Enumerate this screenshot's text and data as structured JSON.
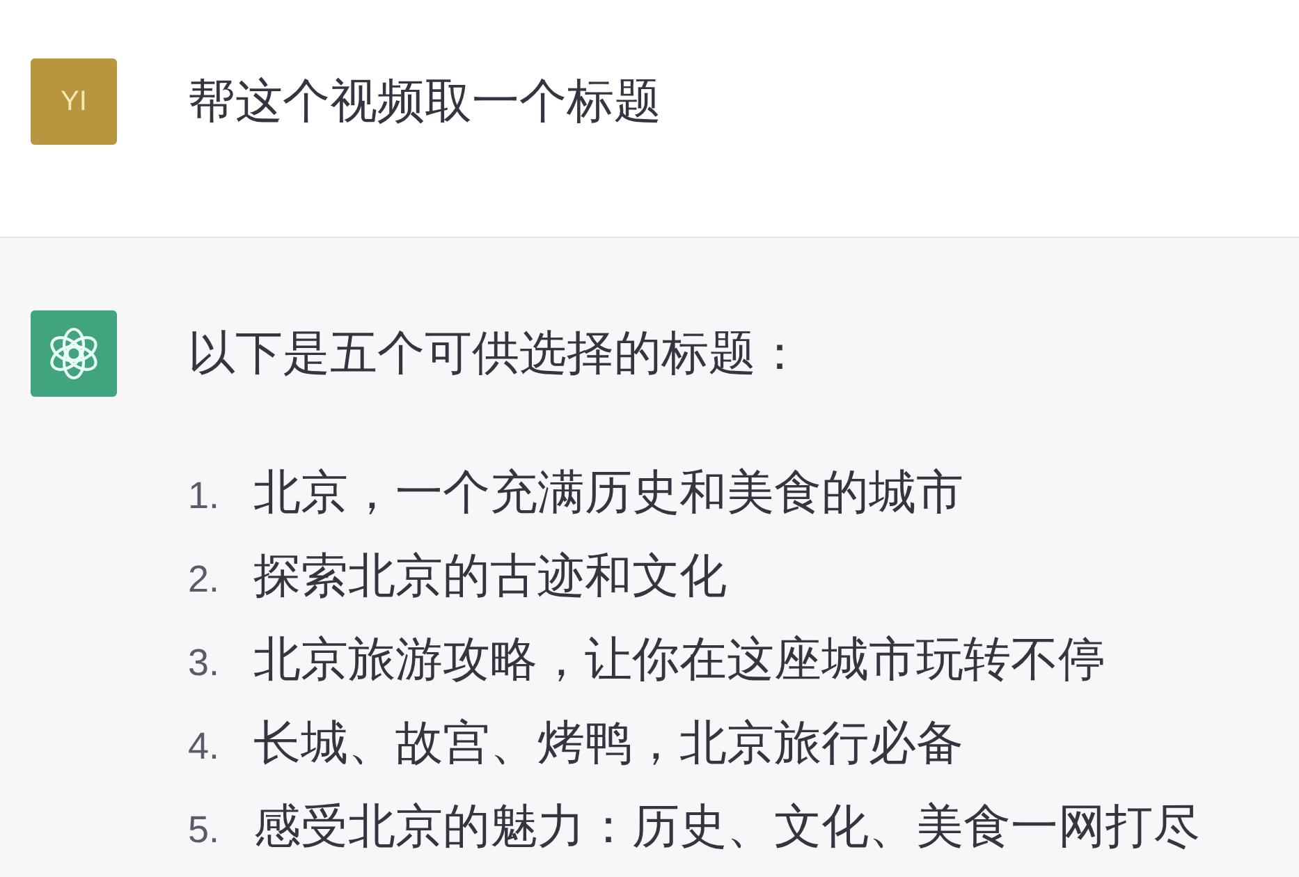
{
  "messages": [
    {
      "kind": "user",
      "avatar": {
        "kind": "initials",
        "text": "YI"
      },
      "text": "帮这个视频取一个标题"
    },
    {
      "kind": "assistant",
      "avatar": {
        "kind": "logo"
      },
      "text": "以下是五个可供选择的标题：",
      "list": [
        {
          "number": "1.",
          "text": "北京，一个充满历史和美食的城市"
        },
        {
          "number": "2.",
          "text": "探索北京的古迹和文化"
        },
        {
          "number": "3.",
          "text": "北京旅游攻略，让你在这座城市玩转不停"
        },
        {
          "number": "4.",
          "text": "长城、故宫、烤鸭，北京旅行必备"
        },
        {
          "number": "5.",
          "text": "感受北京的魅力：历史、文化、美食一网打尽"
        }
      ]
    }
  ]
}
